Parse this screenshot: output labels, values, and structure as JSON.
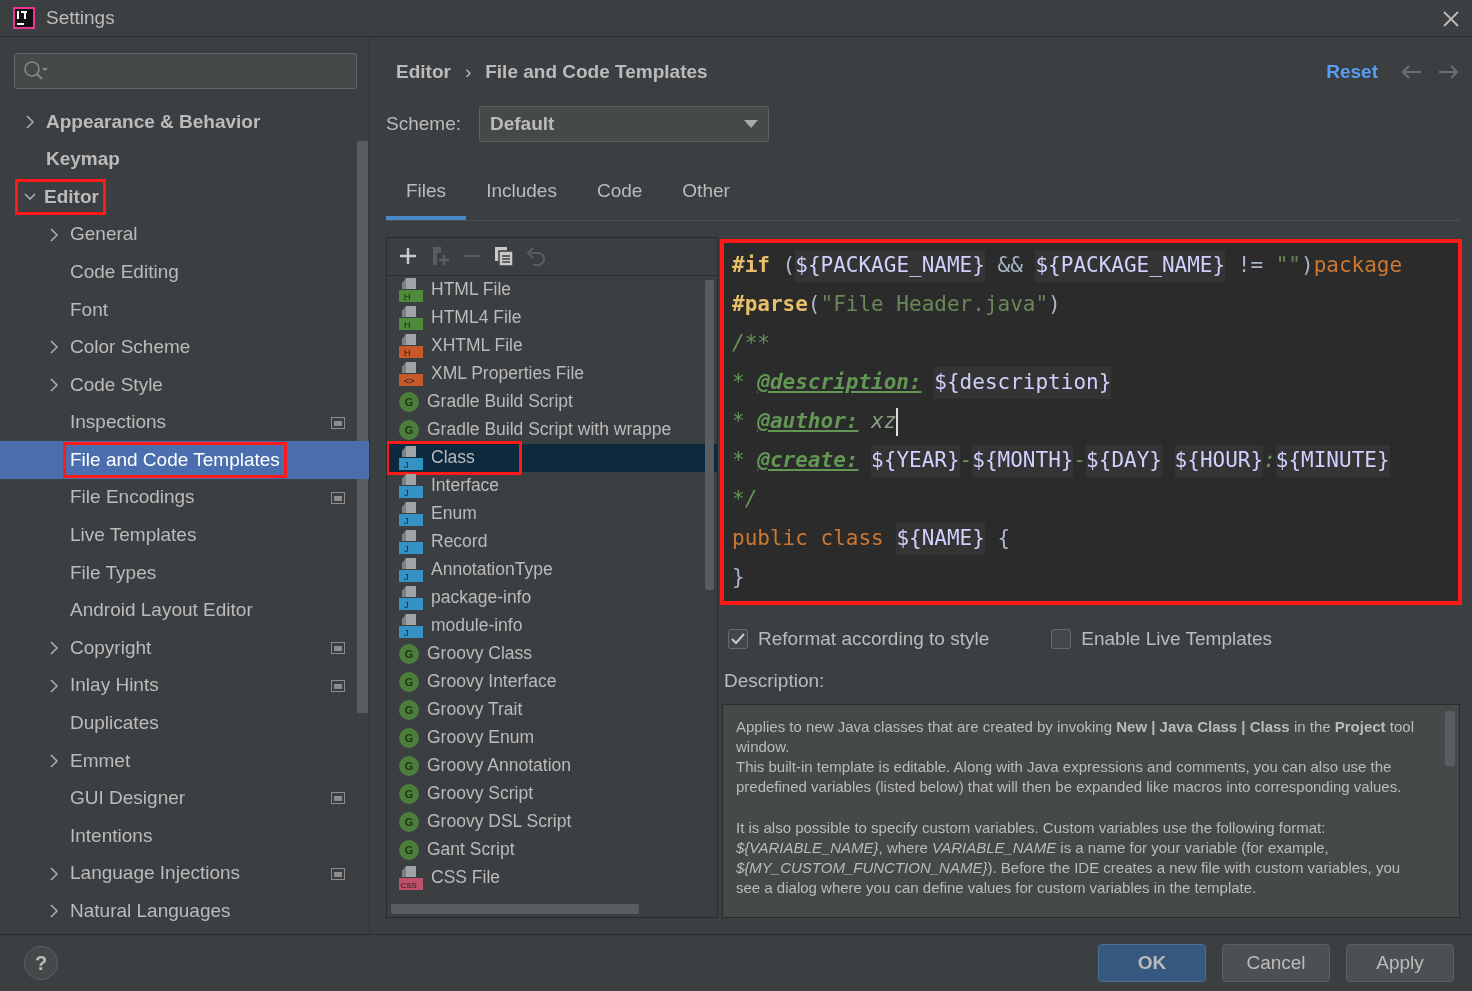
{
  "window": {
    "title": "Settings"
  },
  "sidebar": {
    "items": [
      {
        "label": "Appearance & Behavior",
        "expandable": true,
        "expanded": false,
        "selected": false,
        "highlighted": false,
        "project_scope": false
      },
      {
        "label": "Keymap",
        "expandable": false,
        "selected": false,
        "highlighted": false,
        "project_scope": false
      },
      {
        "label": "Editor",
        "expandable": true,
        "expanded": true,
        "selected": false,
        "highlighted": true,
        "project_scope": false,
        "children": [
          {
            "label": "General",
            "expandable": true,
            "expanded": false,
            "selected": false,
            "highlighted": false,
            "project_scope": false
          },
          {
            "label": "Code Editing",
            "expandable": false,
            "selected": false,
            "highlighted": false,
            "project_scope": false
          },
          {
            "label": "Font",
            "expandable": false,
            "selected": false,
            "highlighted": false,
            "project_scope": false
          },
          {
            "label": "Color Scheme",
            "expandable": true,
            "expanded": false,
            "selected": false,
            "highlighted": false,
            "project_scope": false
          },
          {
            "label": "Code Style",
            "expandable": true,
            "expanded": false,
            "selected": false,
            "highlighted": false,
            "project_scope": false
          },
          {
            "label": "Inspections",
            "expandable": false,
            "selected": false,
            "highlighted": false,
            "project_scope": true
          },
          {
            "label": "File and Code Templates",
            "expandable": false,
            "selected": true,
            "highlighted": true,
            "project_scope": false
          },
          {
            "label": "File Encodings",
            "expandable": false,
            "selected": false,
            "highlighted": false,
            "project_scope": true
          },
          {
            "label": "Live Templates",
            "expandable": false,
            "selected": false,
            "highlighted": false,
            "project_scope": false
          },
          {
            "label": "File Types",
            "expandable": false,
            "selected": false,
            "highlighted": false,
            "project_scope": false
          },
          {
            "label": "Android Layout Editor",
            "expandable": false,
            "selected": false,
            "highlighted": false,
            "project_scope": false
          },
          {
            "label": "Copyright",
            "expandable": true,
            "expanded": false,
            "selected": false,
            "highlighted": false,
            "project_scope": true
          },
          {
            "label": "Inlay Hints",
            "expandable": true,
            "expanded": false,
            "selected": false,
            "highlighted": false,
            "project_scope": true
          },
          {
            "label": "Duplicates",
            "expandable": false,
            "selected": false,
            "highlighted": false,
            "project_scope": false
          },
          {
            "label": "Emmet",
            "expandable": true,
            "expanded": false,
            "selected": false,
            "highlighted": false,
            "project_scope": false
          },
          {
            "label": "GUI Designer",
            "expandable": false,
            "selected": false,
            "highlighted": false,
            "project_scope": true
          },
          {
            "label": "Intentions",
            "expandable": false,
            "selected": false,
            "highlighted": false,
            "project_scope": false
          },
          {
            "label": "Language Injections",
            "expandable": true,
            "expanded": false,
            "selected": false,
            "highlighted": false,
            "project_scope": true
          },
          {
            "label": "Natural Languages",
            "expandable": true,
            "expanded": false,
            "selected": false,
            "highlighted": false,
            "project_scope": false
          }
        ]
      }
    ]
  },
  "header": {
    "breadcrumbs": [
      "Editor",
      "File and Code Templates"
    ],
    "separator": "›",
    "reset": "Reset"
  },
  "scheme": {
    "label": "Scheme:",
    "value": "Default"
  },
  "tabs": [
    {
      "label": "Files",
      "selected": true
    },
    {
      "label": "Includes",
      "selected": false
    },
    {
      "label": "Code",
      "selected": false
    },
    {
      "label": "Other",
      "selected": false
    }
  ],
  "toolbar": [
    {
      "kind": "add",
      "disabled": false
    },
    {
      "kind": "add-child",
      "disabled": true
    },
    {
      "kind": "remove",
      "disabled": true
    },
    {
      "kind": "copy",
      "disabled": false
    },
    {
      "kind": "reset",
      "disabled": true
    }
  ],
  "templates": [
    {
      "label": "HTML File",
      "kind": "file",
      "badge": "H",
      "color": "#4e8a3a",
      "selected": false,
      "highlighted": false
    },
    {
      "label": "HTML4 File",
      "kind": "file",
      "badge": "H",
      "color": "#4e8a3a",
      "selected": false,
      "highlighted": false
    },
    {
      "label": "XHTML File",
      "kind": "file",
      "badge": "H",
      "color": "#c7582a",
      "selected": false,
      "highlighted": false
    },
    {
      "label": "XML Properties File",
      "kind": "file",
      "badge": "<>",
      "color": "#c7582a",
      "selected": false,
      "highlighted": false
    },
    {
      "label": "Gradle Build Script",
      "kind": "circle",
      "badge": "G",
      "color": "#4c7d3b",
      "selected": false,
      "highlighted": false
    },
    {
      "label": "Gradle Build Script with wrappe",
      "kind": "circle",
      "badge": "G",
      "color": "#4c7d3b",
      "selected": false,
      "highlighted": false
    },
    {
      "label": "Class",
      "kind": "file",
      "badge": "J",
      "color": "#3592c4",
      "selected": true,
      "highlighted": true
    },
    {
      "label": "Interface",
      "kind": "file",
      "badge": "J",
      "color": "#3592c4",
      "selected": false,
      "highlighted": false
    },
    {
      "label": "Enum",
      "kind": "file",
      "badge": "J",
      "color": "#3592c4",
      "selected": false,
      "highlighted": false
    },
    {
      "label": "Record",
      "kind": "file",
      "badge": "J",
      "color": "#3592c4",
      "selected": false,
      "highlighted": false
    },
    {
      "label": "AnnotationType",
      "kind": "file",
      "badge": "J",
      "color": "#3592c4",
      "selected": false,
      "highlighted": false
    },
    {
      "label": "package-info",
      "kind": "file",
      "badge": "J",
      "color": "#3592c4",
      "selected": false,
      "highlighted": false
    },
    {
      "label": "module-info",
      "kind": "file",
      "badge": "J",
      "color": "#3592c4",
      "selected": false,
      "highlighted": false
    },
    {
      "label": "Groovy Class",
      "kind": "circle",
      "badge": "G",
      "color": "#4c7d3b",
      "selected": false,
      "highlighted": false
    },
    {
      "label": "Groovy Interface",
      "kind": "circle",
      "badge": "G",
      "color": "#4c7d3b",
      "selected": false,
      "highlighted": false
    },
    {
      "label": "Groovy Trait",
      "kind": "circle",
      "badge": "G",
      "color": "#4c7d3b",
      "selected": false,
      "highlighted": false
    },
    {
      "label": "Groovy Enum",
      "kind": "circle",
      "badge": "G",
      "color": "#4c7d3b",
      "selected": false,
      "highlighted": false
    },
    {
      "label": "Groovy Annotation",
      "kind": "circle",
      "badge": "G",
      "color": "#4c7d3b",
      "selected": false,
      "highlighted": false
    },
    {
      "label": "Groovy Script",
      "kind": "circle",
      "badge": "G",
      "color": "#4c7d3b",
      "selected": false,
      "highlighted": false
    },
    {
      "label": "Groovy DSL Script",
      "kind": "circle",
      "badge": "G",
      "color": "#4c7d3b",
      "selected": false,
      "highlighted": false
    },
    {
      "label": "Gant Script",
      "kind": "circle",
      "badge": "G",
      "color": "#4c7d3b",
      "selected": false,
      "highlighted": false
    },
    {
      "label": "CSS File",
      "kind": "file",
      "badge": "CSS",
      "color": "#c0506a",
      "selected": false,
      "highlighted": false
    }
  ],
  "editor": {
    "highlighted": true,
    "lines": [
      [
        {
          "text": "#if",
          "kind": "directive"
        },
        {
          "text": " (",
          "kind": "punct"
        },
        {
          "text": "${PACKAGE_NAME}",
          "kind": "var"
        },
        {
          "text": " && ",
          "kind": "punct"
        },
        {
          "text": "${PACKAGE_NAME}",
          "kind": "var"
        },
        {
          "text": " != ",
          "kind": "punct"
        },
        {
          "text": "\"\"",
          "kind": "string"
        },
        {
          "text": ")",
          "kind": "punct"
        },
        {
          "text": "package",
          "kind": "keyword"
        }
      ],
      [
        {
          "text": "#parse",
          "kind": "directive"
        },
        {
          "text": "(",
          "kind": "punct"
        },
        {
          "text": "\"File Header.java\"",
          "kind": "string"
        },
        {
          "text": ")",
          "kind": "punct"
        }
      ],
      [
        {
          "text": "/**",
          "kind": "comment"
        }
      ],
      [
        {
          "text": "* ",
          "kind": "comment"
        },
        {
          "text": "@description:",
          "kind": "doctag"
        },
        {
          "text": " ${description}",
          "kind": "var"
        }
      ],
      [
        {
          "text": "* ",
          "kind": "comment"
        },
        {
          "text": "@author:",
          "kind": "doctag"
        },
        {
          "text": " xz",
          "kind": "doctext"
        },
        {
          "kind": "caret"
        }
      ],
      [
        {
          "text": "* ",
          "kind": "comment"
        },
        {
          "text": "@create:",
          "kind": "doctag"
        },
        {
          "text": " ${YEAR}",
          "kind": "var"
        },
        {
          "text": "-",
          "kind": "comment"
        },
        {
          "text": "${MONTH}",
          "kind": "var"
        },
        {
          "text": "-",
          "kind": "comment"
        },
        {
          "text": "${DAY}",
          "kind": "var"
        },
        {
          "text": " ${HOUR}",
          "kind": "var"
        },
        {
          "text": ":",
          "kind": "comment"
        },
        {
          "text": "${MINUTE}",
          "kind": "var"
        }
      ],
      [
        {
          "text": "*/",
          "kind": "comment"
        }
      ],
      [
        {
          "text": "public class ",
          "kind": "keyword"
        },
        {
          "text": "${NAME}",
          "kind": "var"
        },
        {
          "text": " {",
          "kind": "punct"
        }
      ],
      [
        {
          "text": "}",
          "kind": "punct"
        }
      ]
    ]
  },
  "options": [
    {
      "label": "Reformat according to style",
      "checked": true
    },
    {
      "label": "Enable Live Templates",
      "checked": false
    }
  ],
  "description": {
    "label": "Description:",
    "paragraphs": [
      [
        "Applies to new Java classes that are created by invoking **New | Java Class | Class** in the **Project** tool window.",
        "This built-in template is editable. Along with Java expressions and comments, you can also use the predefined variables (listed below) that will then be expanded like macros into corresponding values."
      ],
      [
        "It is also possible to specify custom variables. Custom variables use the following format: *${VARIABLE_NAME}*, where *VARIABLE_NAME* is a name for your variable (for example, *${MY_CUSTOM_FUNCTION_NAME}*). Before the IDE creates a new file with custom variables, you see a dialog where you can define values for custom variables in the template."
      ]
    ]
  },
  "footer": {
    "help": "?",
    "buttons": [
      {
        "label": "OK",
        "kind": "primary"
      },
      {
        "label": "Cancel",
        "kind": "default"
      },
      {
        "label": "Apply",
        "kind": "default"
      }
    ]
  }
}
